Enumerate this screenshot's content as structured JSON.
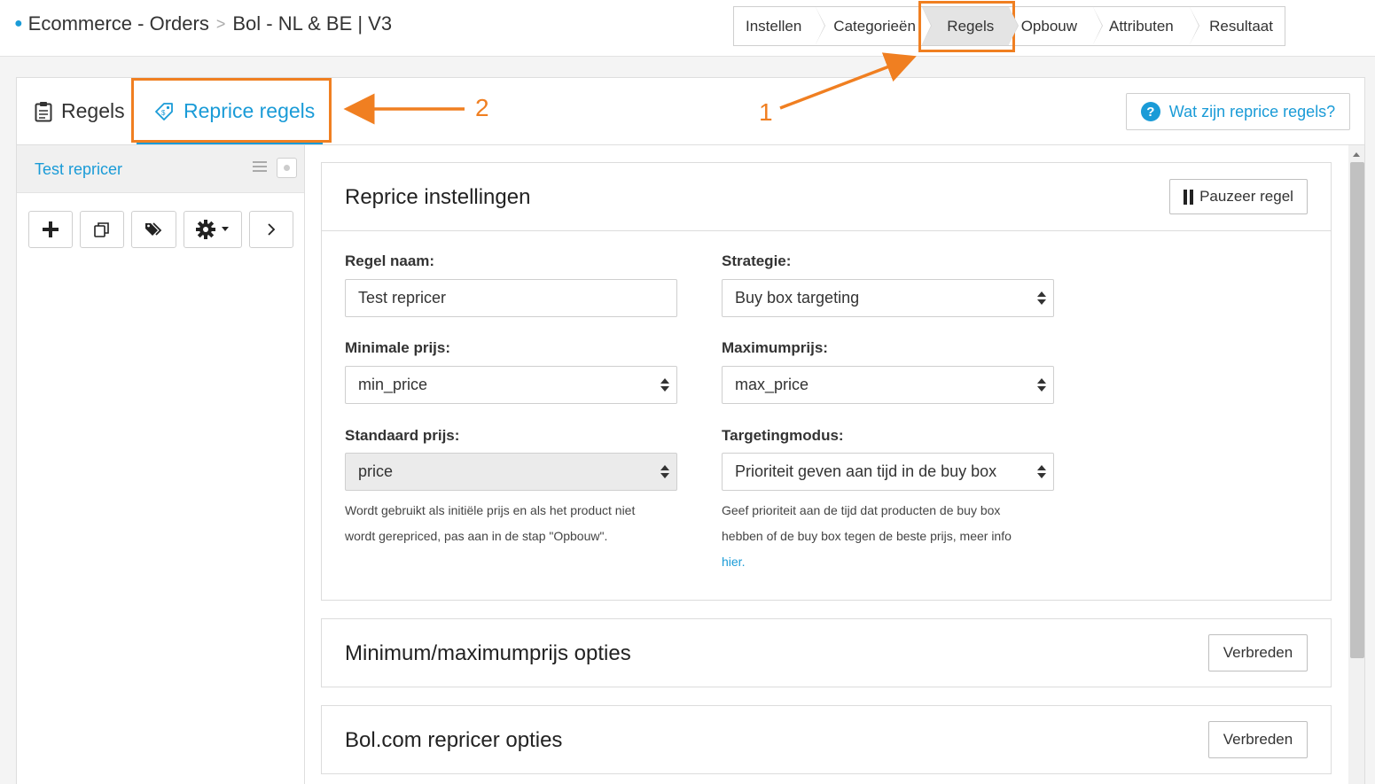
{
  "breadcrumb": {
    "items": [
      "Ecommerce - Orders",
      "Bol - NL & BE | V3"
    ],
    "separator": ">"
  },
  "steps": [
    "Instellen",
    "Categorieën",
    "Regels",
    "Opbouw",
    "Attributen",
    "Resultaat"
  ],
  "active_step": "Regels",
  "tabs": {
    "rules": "Regels",
    "reprice": "Reprice regels"
  },
  "help_button": "Wat zijn reprice regels?",
  "annotations": {
    "one": "1",
    "two": "2",
    "color": "#f07f21"
  },
  "sidebar": {
    "rule_name": "Test repricer",
    "toolbar": {
      "add_icon": "plus-icon",
      "copy_icon": "copy-icon",
      "tags_icon": "tags-icon",
      "settings_icon": "gear-icon",
      "next_icon": "chevron-right-icon"
    }
  },
  "settings": {
    "title": "Reprice instellingen",
    "pause_button": "Pauzeer regel",
    "rule_name_label": "Regel naam:",
    "rule_name_value": "Test repricer",
    "strategy_label": "Strategie:",
    "strategy_value": "Buy box targeting",
    "min_price_label": "Minimale prijs:",
    "min_price_value": "min_price",
    "max_price_label": "Maximumprijs:",
    "max_price_value": "max_price",
    "std_price_label": "Standaard prijs:",
    "std_price_value": "price",
    "std_price_help_1": "Wordt gebruikt als initiële prijs en als het product niet",
    "std_price_help_2": "wordt gerepriced, pas aan in de stap \"Opbouw\".",
    "targeting_label": "Targetingmodus:",
    "targeting_value": "Prioriteit geven aan tijd in de buy box",
    "targeting_help_1": "Geef prioriteit aan de tijd dat producten de buy box",
    "targeting_help_2": "hebben of de buy box tegen de beste prijs, meer info",
    "targeting_help_link": "hier",
    "targeting_help_end": "."
  },
  "sections": [
    {
      "title": "Minimum/maximumprijs opties",
      "button": "Verbreden"
    },
    {
      "title": "Bol.com repricer opties",
      "button": "Verbreden"
    }
  ],
  "colors": {
    "accent": "#1a9bd7",
    "annotation": "#f07f21"
  }
}
